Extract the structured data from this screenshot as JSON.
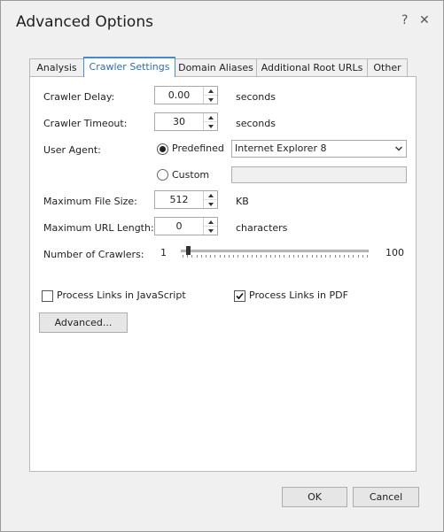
{
  "window": {
    "title": "Advanced Options",
    "help_label": "?",
    "close_label": "✕"
  },
  "tabs": [
    {
      "label": "Analysis",
      "active": false
    },
    {
      "label": "Crawler Settings",
      "active": true
    },
    {
      "label": "Domain Aliases",
      "active": false
    },
    {
      "label": "Additional Root URLs",
      "active": false
    },
    {
      "label": "Other",
      "active": false
    }
  ],
  "crawler": {
    "delay": {
      "label": "Crawler Delay:",
      "value": "0.00",
      "unit": "seconds"
    },
    "timeout": {
      "label": "Crawler Timeout:",
      "value": "30",
      "unit": "seconds"
    },
    "user_agent": {
      "label": "User Agent:",
      "predefined_label": "Predefined",
      "predefined_selected": true,
      "predefined_value": "Internet Explorer 8",
      "custom_label": "Custom",
      "custom_value": ""
    },
    "max_file_size": {
      "label": "Maximum File Size:",
      "value": "512",
      "unit": "KB"
    },
    "max_url_length": {
      "label": "Maximum URL Length:",
      "value": "0",
      "unit": "characters"
    },
    "num_crawlers": {
      "label": "Number of Crawlers:",
      "min_label": "1",
      "max_label": "100",
      "value": 1
    }
  },
  "options": {
    "js_links": {
      "label": "Process Links in JavaScript",
      "checked": false
    },
    "pdf_links": {
      "label": "Process Links in PDF",
      "checked": true
    },
    "advanced_button": "Advanced..."
  },
  "footer": {
    "ok_label": "OK",
    "cancel_label": "Cancel"
  }
}
